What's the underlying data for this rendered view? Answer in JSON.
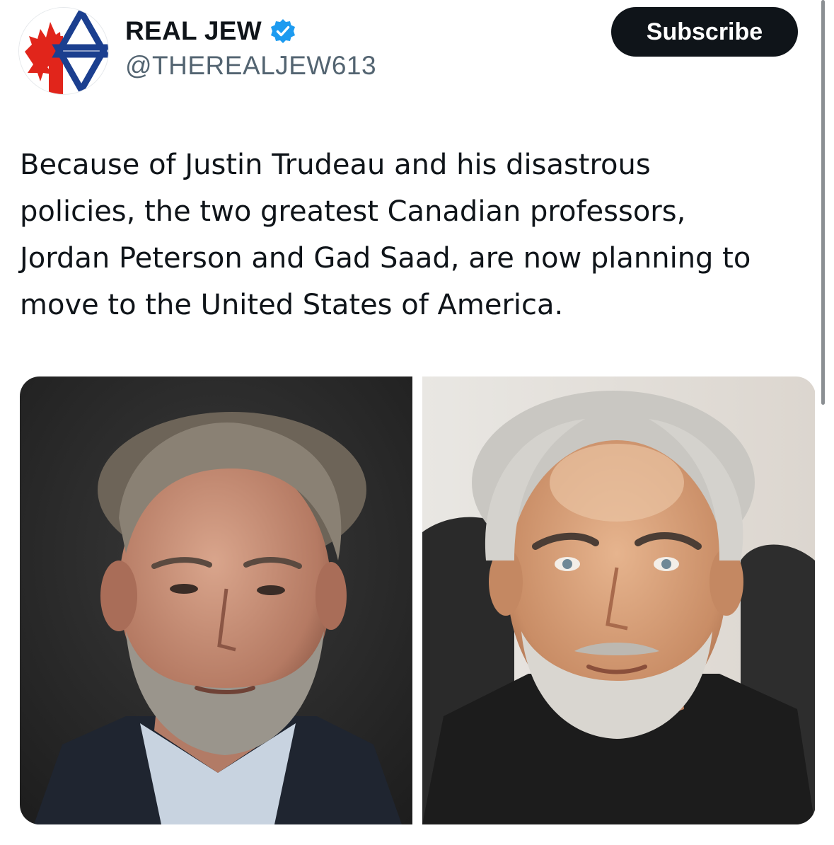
{
  "author": {
    "display_name": "REAL JEW",
    "handle": "@THEREALJEW613",
    "verified": true,
    "avatar_icon": "canada-maple-leaf-star-of-david-avatar"
  },
  "header": {
    "subscribe_label": "Subscribe"
  },
  "tweet": {
    "text_lines": [
      "Because of Justin Trudeau and his disastrous",
      "policies, the two greatest Canadian professors,",
      "Jordan Peterson and Gad Saad, are now planning to",
      "move to the United States of America."
    ]
  },
  "media": {
    "photos": [
      {
        "subject": "portrait-photo-left",
        "background": "#2b2b2b"
      },
      {
        "subject": "portrait-photo-right",
        "background": "#e4e1dc"
      }
    ]
  },
  "colors": {
    "text_primary": "#0f1419",
    "text_secondary": "#536471",
    "verified_blue": "#1d9bf0",
    "button_bg": "#0f1419",
    "flag_red": "#e1251b",
    "star_blue": "#1b3f8f"
  }
}
